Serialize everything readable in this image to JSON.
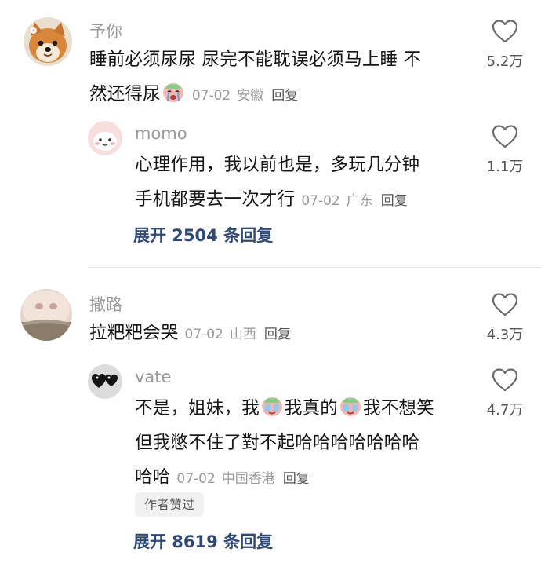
{
  "comments": [
    {
      "username": "予你",
      "text_line1": "睡前必须尿尿 尿完不能耽误必须马上睡 不",
      "text_line2": "然还得尿",
      "date": "07-02",
      "location": "安徽",
      "reply_label": "回复",
      "likes": "5.2万",
      "avatar_icon": "shiba-dog-avatar-icon",
      "replies": [
        {
          "username": "momo",
          "text_line1": "心理作用，我以前也是，多玩几分钟",
          "text_line2": "手机都要去一次才行",
          "date": "07-02",
          "location": "广东",
          "reply_label": "回复",
          "likes": "1.1万",
          "avatar_icon": "cartoon-creature-avatar-icon"
        }
      ],
      "expand": "展开 2504 条回复"
    },
    {
      "username": "撒路",
      "text_line1": "拉粑粑会哭",
      "date": "07-02",
      "location": "山西",
      "reply_label": "回复",
      "likes": "4.3万",
      "avatar_icon": "hamster-face-avatar-icon",
      "replies": [
        {
          "username": "vate",
          "text_seg1": "不是，姐妹，我",
          "text_seg2": "我真的",
          "text_seg3": "我不想笑",
          "text_line2": "但我憋不住了對不起哈哈哈哈哈哈哈",
          "text_line3": "哈哈",
          "date": "07-02",
          "location": "中国香港",
          "reply_label": "回复",
          "likes": "4.7万",
          "author_liked": "作者赞过",
          "avatar_icon": "black-hearts-avatar-icon"
        }
      ],
      "expand": "展开 8619 条回复"
    }
  ],
  "colors": {
    "name_gray": "#9a9a9a",
    "text": "#161616",
    "link_blue": "#2f4a78",
    "divider": "#e5e5e5"
  }
}
